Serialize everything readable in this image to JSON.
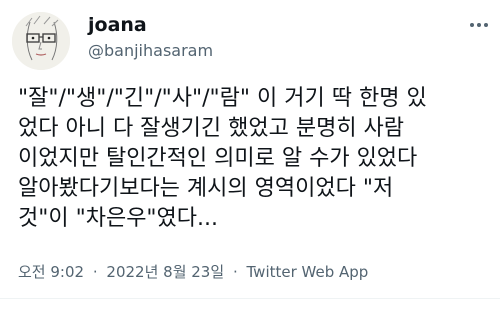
{
  "author": {
    "display_name": "joana",
    "handle": "@banjihasaram"
  },
  "tweet": {
    "lines": [
      "\"잘\"/\"생\"/\"긴\"/\"사\"/\"람\" 이 거기 딱 한명 있",
      "었다  아니 다 잘생기긴 했었고 분명히 사람",
      "이었지만 탈인간적인 의미로 알 수가 있었다",
      "알아봤다기보다는 계시의 영역이었다 \"저",
      "것\"이 \"차은우\"였다..."
    ]
  },
  "meta": {
    "time": "오전 9:02",
    "separator": "·",
    "date": "2022년 8월 23일",
    "source": "Twitter Web App"
  },
  "icons": {
    "more": "more-options-icon",
    "avatar": "avatar-face-sketch"
  },
  "colors": {
    "text": "#0f1419",
    "secondary": "#536471",
    "divider": "#eff3f4"
  }
}
